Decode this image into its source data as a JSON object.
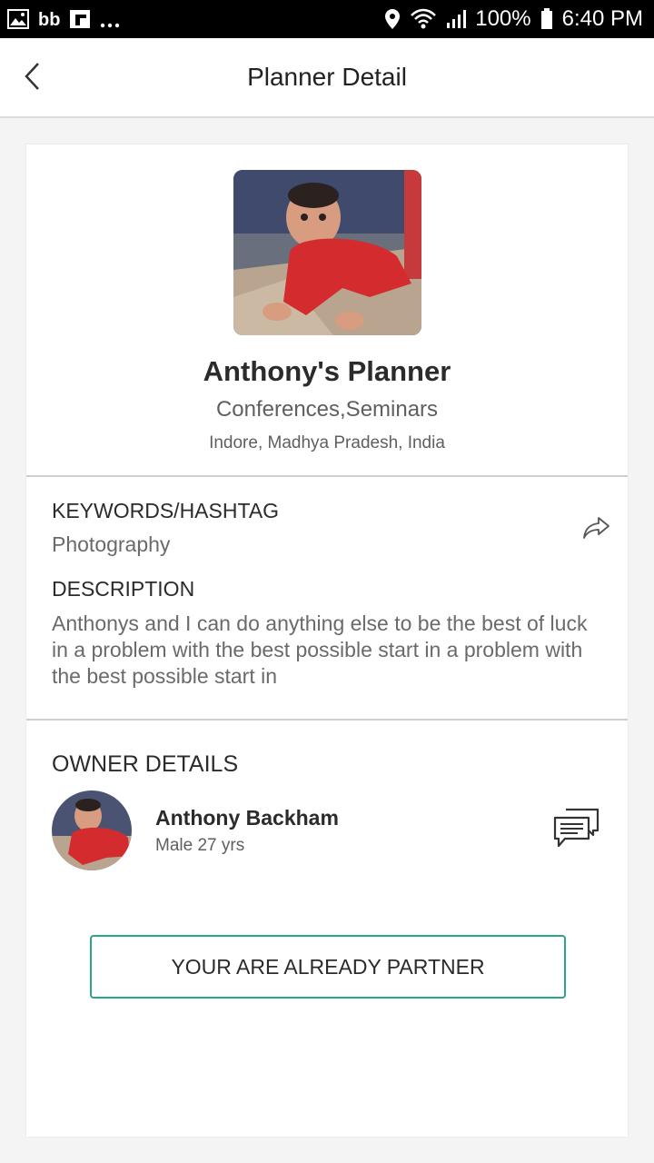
{
  "status_bar": {
    "battery": "100%",
    "time": "6:40 PM",
    "left_icons": [
      "gallery-icon",
      "bigbasket-icon",
      "flipboard-icon",
      "more-notifications-icon"
    ],
    "right_icons": [
      "location-icon",
      "wifi-icon",
      "signal-icon",
      "battery-icon"
    ]
  },
  "app_bar": {
    "title": "Planner Detail",
    "back_icon": "back-chevron-icon"
  },
  "planner": {
    "name": "Anthony's Planner",
    "category": "Conferences,Seminars",
    "location": "Indore, Madhya Pradesh, India"
  },
  "keywords": {
    "heading": "KEYWORDS/HASHTAG",
    "value": "Photography",
    "share_icon": "share-icon"
  },
  "description": {
    "heading": "DESCRIPTION",
    "text": "Anthonys and I can do anything else to be the best of luck in a problem with the best possible start in a problem with the best possible start in"
  },
  "owner": {
    "heading": "OWNER DETAILS",
    "name": "Anthony Backham",
    "meta": "Male 27 yrs",
    "chat_icon": "chat-icon"
  },
  "partner_button": {
    "label": "YOUR ARE ALREADY PARTNER",
    "border_color": "#2aa586"
  },
  "colors": {
    "accent": "#2aa586",
    "background": "#f4f4f4",
    "status_bar": "#000000"
  }
}
